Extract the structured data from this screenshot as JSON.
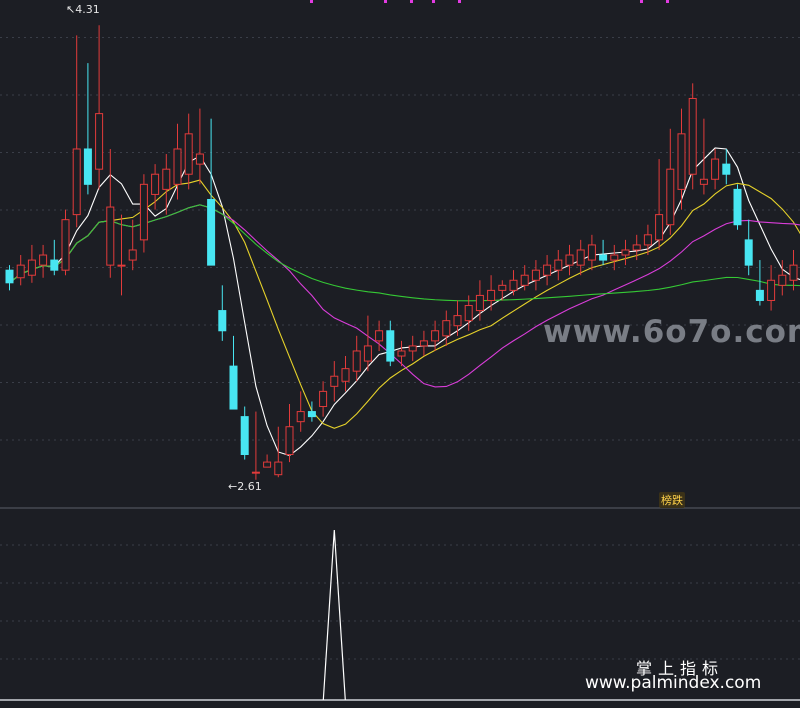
{
  "chart_data": {
    "type": "candlestick",
    "annotations": {
      "high_label": "4.31",
      "low_label": "2.61",
      "signal_label": "榜跌"
    },
    "y_range": [
      2.45,
      4.45
    ],
    "candles": [
      [
        3.38,
        3.4,
        3.3,
        3.33
      ],
      [
        3.35,
        3.44,
        3.32,
        3.4
      ],
      [
        3.36,
        3.48,
        3.33,
        3.42
      ],
      [
        3.4,
        3.48,
        3.35,
        3.44
      ],
      [
        3.42,
        3.5,
        3.36,
        3.38
      ],
      [
        3.38,
        3.62,
        3.36,
        3.58
      ],
      [
        3.6,
        4.31,
        3.55,
        3.86
      ],
      [
        3.86,
        4.2,
        3.68,
        3.72
      ],
      [
        3.78,
        4.35,
        3.7,
        4.0
      ],
      [
        3.4,
        3.86,
        3.35,
        3.63
      ],
      [
        3.4,
        3.6,
        3.28,
        3.4
      ],
      [
        3.42,
        3.58,
        3.38,
        3.46
      ],
      [
        3.5,
        3.76,
        3.45,
        3.72
      ],
      [
        3.68,
        3.8,
        3.62,
        3.76
      ],
      [
        3.7,
        3.84,
        3.6,
        3.78
      ],
      [
        3.72,
        3.96,
        3.66,
        3.86
      ],
      [
        3.76,
        4.0,
        3.7,
        3.92
      ],
      [
        3.8,
        4.02,
        3.72,
        3.84
      ],
      [
        3.66,
        3.98,
        3.56,
        3.4
      ],
      [
        3.22,
        3.32,
        3.1,
        3.14
      ],
      [
        3.0,
        3.12,
        2.96,
        2.83
      ],
      [
        2.8,
        2.84,
        2.63,
        2.65
      ],
      [
        2.58,
        2.82,
        2.55,
        2.58
      ],
      [
        2.6,
        2.65,
        2.61,
        2.62
      ],
      [
        2.57,
        2.76,
        2.56,
        2.62
      ],
      [
        2.65,
        2.85,
        2.62,
        2.76
      ],
      [
        2.78,
        2.9,
        2.74,
        2.82
      ],
      [
        2.82,
        2.86,
        2.78,
        2.8
      ],
      [
        2.84,
        2.94,
        2.8,
        2.9
      ],
      [
        2.92,
        3.02,
        2.86,
        2.96
      ],
      [
        2.94,
        3.04,
        2.9,
        2.99
      ],
      [
        2.98,
        3.12,
        2.94,
        3.06
      ],
      [
        3.02,
        3.2,
        2.98,
        3.08
      ],
      [
        3.1,
        3.18,
        3.06,
        3.14
      ],
      [
        3.14,
        3.18,
        3.0,
        3.02
      ],
      [
        3.04,
        3.1,
        3.0,
        3.06
      ],
      [
        3.06,
        3.12,
        3.02,
        3.08
      ],
      [
        3.08,
        3.14,
        3.04,
        3.1
      ],
      [
        3.1,
        3.18,
        3.06,
        3.14
      ],
      [
        3.12,
        3.22,
        3.08,
        3.18
      ],
      [
        3.16,
        3.26,
        3.12,
        3.2
      ],
      [
        3.18,
        3.28,
        3.14,
        3.24
      ],
      [
        3.22,
        3.34,
        3.18,
        3.28
      ],
      [
        3.26,
        3.36,
        3.22,
        3.3
      ],
      [
        3.3,
        3.34,
        3.26,
        3.32
      ],
      [
        3.3,
        3.38,
        3.28,
        3.34
      ],
      [
        3.32,
        3.4,
        3.3,
        3.36
      ],
      [
        3.34,
        3.42,
        3.3,
        3.38
      ],
      [
        3.36,
        3.44,
        3.32,
        3.4
      ],
      [
        3.38,
        3.46,
        3.34,
        3.42
      ],
      [
        3.4,
        3.48,
        3.36,
        3.44
      ],
      [
        3.4,
        3.5,
        3.36,
        3.46
      ],
      [
        3.42,
        3.52,
        3.38,
        3.48
      ],
      [
        3.44,
        3.5,
        3.4,
        3.42
      ],
      [
        3.42,
        3.48,
        3.38,
        3.44
      ],
      [
        3.44,
        3.5,
        3.4,
        3.46
      ],
      [
        3.46,
        3.52,
        3.42,
        3.48
      ],
      [
        3.48,
        3.56,
        3.44,
        3.52
      ],
      [
        3.5,
        3.82,
        3.46,
        3.6
      ],
      [
        3.56,
        3.94,
        3.52,
        3.78
      ],
      [
        3.7,
        4.02,
        3.62,
        3.92
      ],
      [
        3.76,
        4.12,
        3.7,
        4.06
      ],
      [
        3.72,
        3.98,
        3.68,
        3.74
      ],
      [
        3.74,
        3.86,
        3.7,
        3.82
      ],
      [
        3.8,
        3.86,
        3.72,
        3.76
      ],
      [
        3.7,
        3.72,
        3.54,
        3.56
      ],
      [
        3.5,
        3.58,
        3.36,
        3.4
      ],
      [
        3.3,
        3.42,
        3.24,
        3.26
      ],
      [
        3.26,
        3.4,
        3.22,
        3.34
      ],
      [
        3.32,
        3.42,
        3.28,
        3.36
      ],
      [
        3.34,
        3.46,
        3.3,
        3.4
      ],
      [
        3.38,
        3.48,
        3.34,
        3.32
      ]
    ],
    "indicator_spike_index": 29
  }
}
